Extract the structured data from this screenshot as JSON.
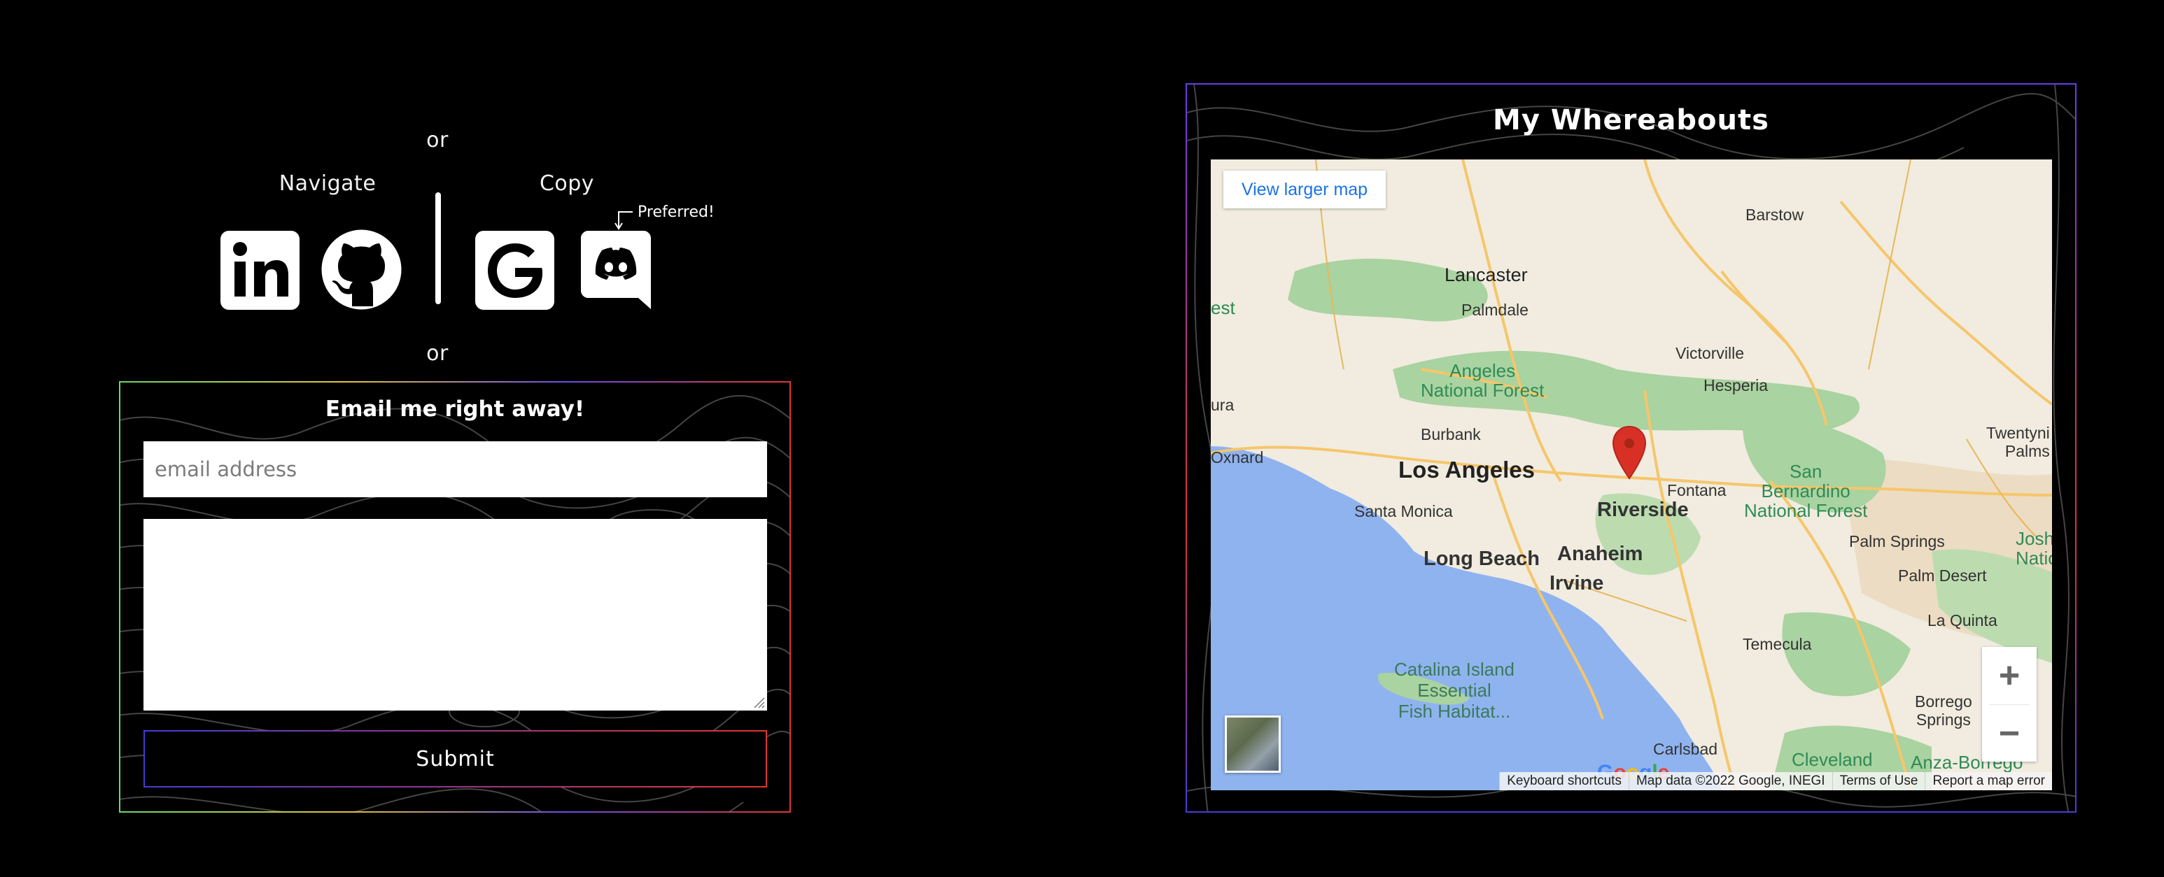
{
  "contact": {
    "or_top": "or",
    "or_bottom": "or",
    "navigate_label": "Navigate",
    "copy_label": "Copy",
    "preferred_label": "Preferred!",
    "icons": [
      "linkedin-icon",
      "github-icon",
      "google-icon",
      "discord-icon"
    ]
  },
  "email_form": {
    "title": "Email me right away!",
    "email_placeholder": "email address",
    "email_value": "",
    "message_value": "",
    "submit_label": "Submit"
  },
  "map_section": {
    "title": "My Whereabouts",
    "view_larger_label": "View larger map",
    "zoom_in": "+",
    "zoom_out": "−",
    "google_logo": "Google",
    "attribution": {
      "shortcuts": "Keyboard shortcuts",
      "data": "Map data ©2022 Google, INEGI",
      "terms": "Terms of Use",
      "report": "Report a map error"
    },
    "labels": {
      "barstow": "Barstow",
      "lancaster": "Lancaster",
      "palmdale": "Palmdale",
      "victorville": "Victorville",
      "hesperia": "Hesperia",
      "angeles_nf": "Angeles\nNational Forest",
      "burbank": "Burbank",
      "los_angeles": "Los Angeles",
      "santa_monica": "Santa Monica",
      "fontana": "Fontana",
      "riverside": "Riverside",
      "san_bernardino_nf": "San\nBernardino\nNational Forest",
      "long_beach": "Long Beach",
      "anaheim": "Anaheim",
      "irvine": "Irvine",
      "palm_springs": "Palm Springs",
      "palm_desert": "Palm Desert",
      "la_quinta": "La Quinta",
      "temecula": "Temecula",
      "twentynine_palms": "Twentyni\nPalms",
      "oxnard": "Oxnard",
      "ura": "ura",
      "est": "est",
      "josh": "Josh\nNatio",
      "catalina": "Catalina Island\nEssential\nFish Habitat...",
      "carlsbad": "Carlsbad",
      "borrego": "Borrego\nSprings",
      "cleveland": "Cleveland",
      "anza_borrego": "Anza-Borrego"
    },
    "colors": {
      "water": "#8fb3ef",
      "land": "#f1ecdf",
      "park": "#a9d3a0",
      "road": "#f6c66b",
      "pin": "#d93025"
    }
  }
}
